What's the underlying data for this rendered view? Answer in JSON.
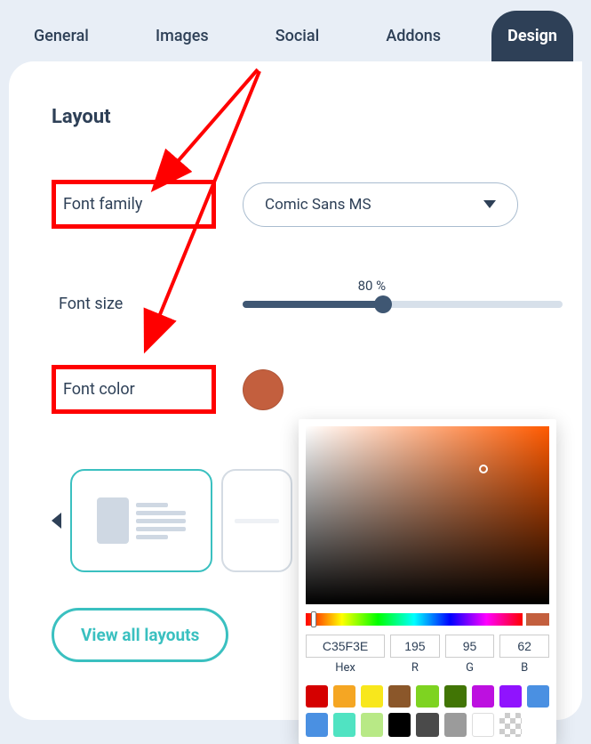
{
  "tabs": {
    "general": "General",
    "images": "Images",
    "social": "Social",
    "addons": "Addons",
    "design": "Design"
  },
  "section_title": "Layout",
  "labels": {
    "font_family": "Font family",
    "font_size": "Font size",
    "font_color": "Font color"
  },
  "font_family_value": "Comic Sans MS",
  "font_size_value": "80 %",
  "view_all": "View all layouts",
  "color": {
    "hex": "C35F3E",
    "r": "195",
    "g": "95",
    "b": "62",
    "hex_label": "Hex",
    "r_label": "R",
    "g_label": "G",
    "b_label": "B"
  },
  "swatches": [
    "#d50000",
    "#f5a623",
    "#f8e71c",
    "#8b572a",
    "#7ed321",
    "#417505",
    "#bd10e0",
    "#9013fe",
    "#4a90e2",
    "#4a90e2",
    "#50e3c2",
    "#b8e986",
    "#000000",
    "#4a4a4a",
    "#9b9b9b",
    "#ffffff",
    "checker"
  ]
}
